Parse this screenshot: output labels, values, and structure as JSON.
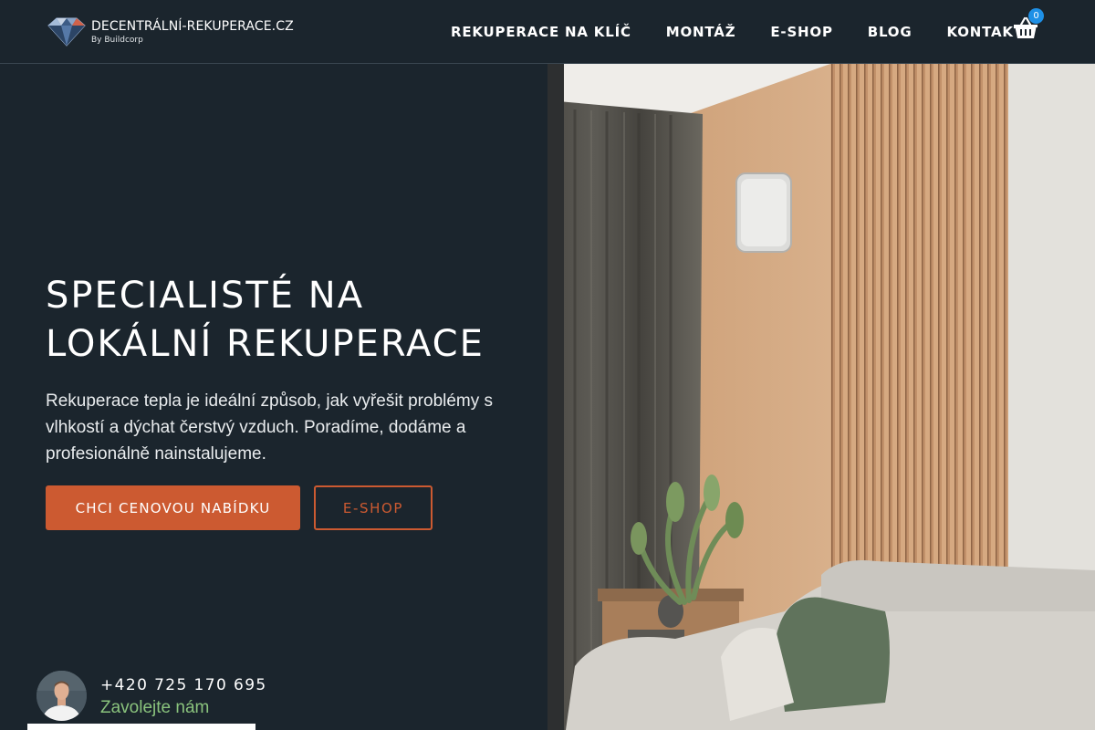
{
  "header": {
    "logo": {
      "name": "DECENTRÁLNÍ-REKUPERACE.CZ",
      "subtitle": "By Buildcorp",
      "icon": "diamond-icon"
    },
    "nav": [
      {
        "label": "REKUPERACE NA KLÍČ"
      },
      {
        "label": "MONTÁŽ"
      },
      {
        "label": "E-SHOP"
      },
      {
        "label": "BLOG"
      },
      {
        "label": "KONTAKT"
      }
    ],
    "cart": {
      "icon": "shopping-basket-icon",
      "count": "0"
    }
  },
  "hero": {
    "title_line1": "SPECIALISTÉ NA",
    "title_line2": "LOKÁLNÍ REKUPERACE",
    "description": "Rekuperace tepla je ideální způsob, jak vyřešit problémy s vlhkostí a dýchat čerstvý vzduch. Poradíme, dodáme a profesionálně nainstalujeme.",
    "primary_button": "CHCI CENOVOU NABÍDKU",
    "secondary_button": "E-SHOP",
    "image_icon": "interior-photo"
  },
  "contact": {
    "phone": "+420 725 170 695",
    "call_label": "Zavolejte nám",
    "avatar_icon": "person-avatar"
  },
  "colors": {
    "background": "#1b252d",
    "accent": "#cc5a31",
    "call_label": "#8ac37d",
    "badge": "#1e90e6"
  }
}
